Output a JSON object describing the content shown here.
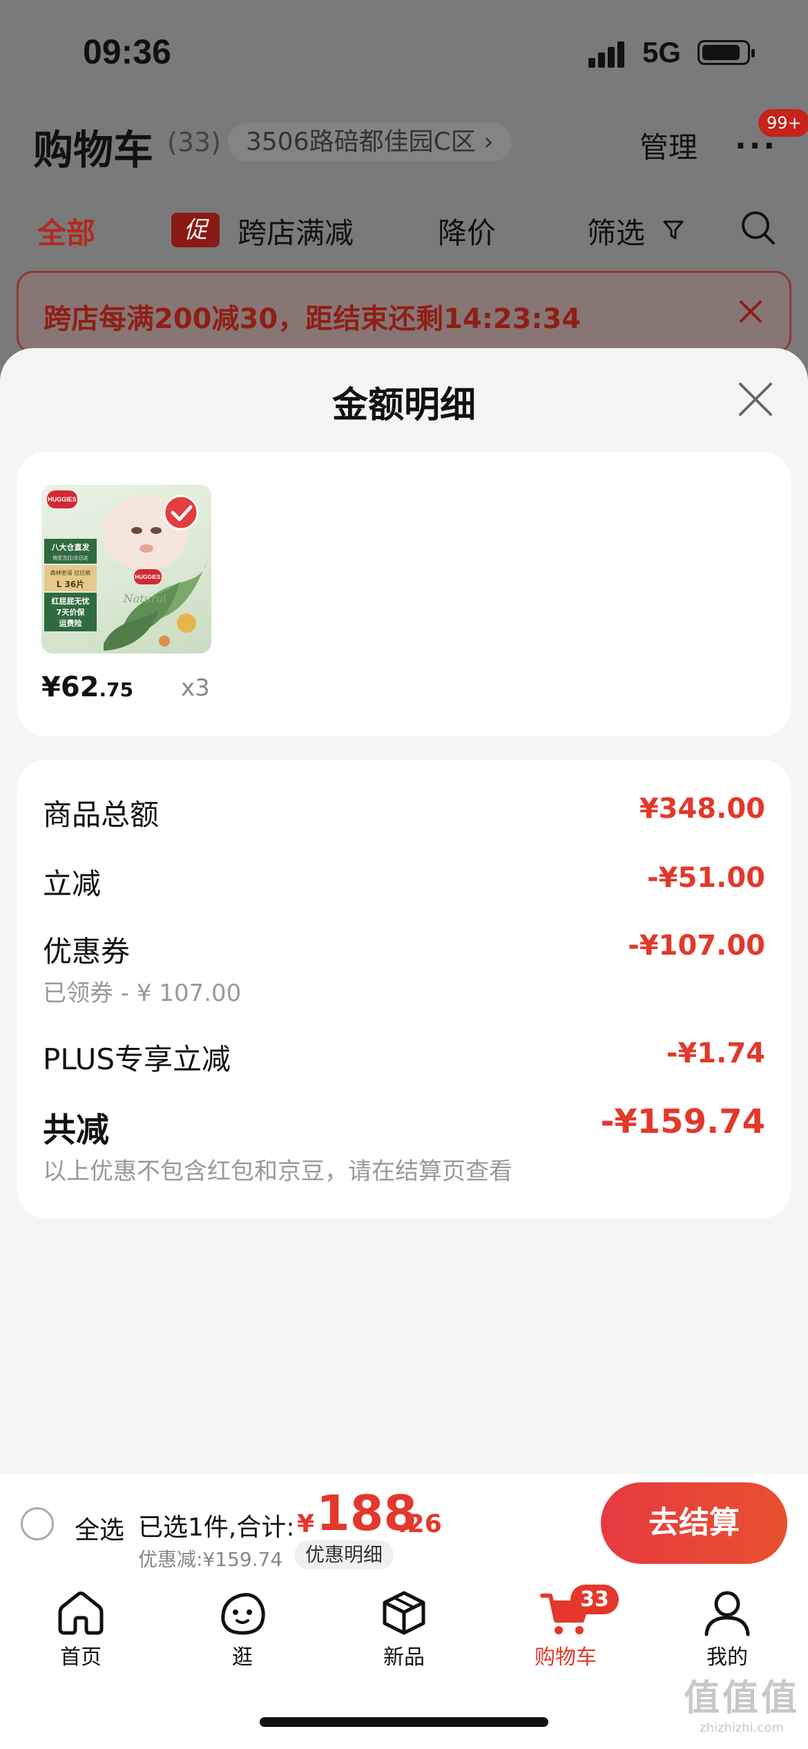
{
  "status_bar": {
    "time": "09:36",
    "network": "5G"
  },
  "header": {
    "title": "购物车",
    "count": "(33)",
    "address": "3506路碚都佳园C区 ›",
    "manage": "管理",
    "more_badge": "99+"
  },
  "tabs": {
    "all": "全部",
    "promo_badge": "促",
    "cross_store": "跨店满减",
    "price_drop": "降价",
    "filter": "筛选"
  },
  "promo_banner": {
    "text": "跨店每满200减30，距结束还剩14:23:34"
  },
  "sheet": {
    "title": "金额明细",
    "product": {
      "brand": "HUGGIES",
      "badge_lines": [
        "八大仓直发",
        "快至当日/次日达",
        "森林密语 拉拉裤",
        "L 36片",
        "红屁屁无忧",
        "7天价保",
        "运费险"
      ],
      "script_word": "Natural",
      "price_symbol": "¥",
      "price_int": "62",
      "price_dec": ".75",
      "qty": "x3"
    },
    "summary": {
      "goods_total_label": "商品总额",
      "goods_total_value": "¥348.00",
      "instant_label": "立减",
      "instant_value": "-¥51.00",
      "coupon_label": "优惠券",
      "coupon_value": "-¥107.00",
      "coupon_sub": "已领券 - ¥ 107.00",
      "plus_label": "PLUS专享立减",
      "plus_value": "-¥1.74",
      "total_label": "共减",
      "total_value": "-¥159.74",
      "note": "以上优惠不包含红包和京豆，请在结算页查看"
    }
  },
  "bottom_bar": {
    "select_all": "全选",
    "selected_info": "已选1件,合计:",
    "total_symbol": "¥",
    "total_int": "188",
    "total_dec": ".26",
    "discount": "优惠减:¥159.74",
    "detail_link": "优惠明细",
    "checkout": "去结算"
  },
  "tab_bar": {
    "items": [
      {
        "label": "首页",
        "icon": "home-icon"
      },
      {
        "label": "逛",
        "icon": "browse-face-icon"
      },
      {
        "label": "新品",
        "icon": "box-icon"
      },
      {
        "label": "购物车",
        "icon": "cart-icon",
        "badge": "33",
        "active": true
      },
      {
        "label": "我的",
        "icon": "person-icon"
      }
    ]
  },
  "watermark": {
    "big": "值值值",
    "small": "zhizhizhi.com"
  },
  "colors": {
    "accent": "#e3382b",
    "overlay": "#7a7a7a",
    "sheet_bg": "#f5f5f5"
  }
}
